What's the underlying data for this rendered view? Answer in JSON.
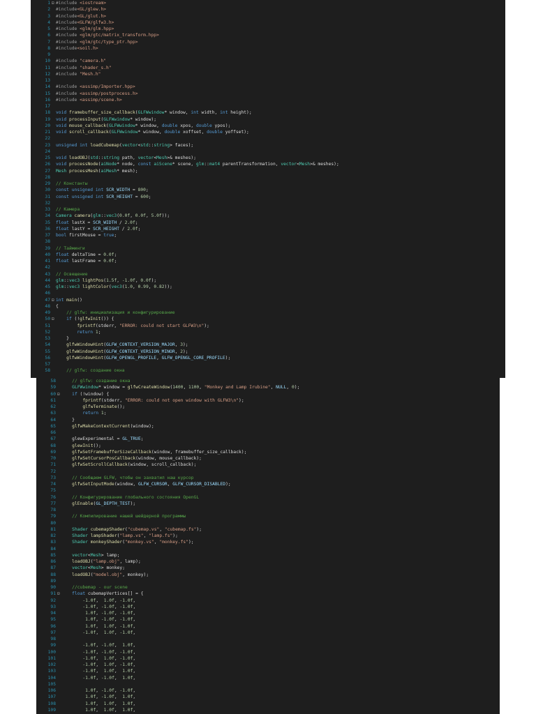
{
  "top_panel": {
    "lines": [
      {
        "n": "1",
        "t": "#include <iostream>"
      },
      {
        "n": "2",
        "t": "#include<GL/glew.h>"
      },
      {
        "n": "3",
        "t": "#include<GL/glut.h>"
      },
      {
        "n": "4",
        "t": "#include<GLFW/glfw3.h>"
      },
      {
        "n": "5",
        "t": "#include <glm/glm.hpp>"
      },
      {
        "n": "6",
        "t": "#include <glm/gtc/matrix_transform.hpp>"
      },
      {
        "n": "7",
        "t": "#include <glm/gtc/type_ptr.hpp>"
      },
      {
        "n": "8",
        "t": "#include<soil.h>"
      },
      {
        "n": "9",
        "t": ""
      },
      {
        "n": "10",
        "t": "#include \"camera.h\""
      },
      {
        "n": "11",
        "t": "#include \"shader_s.h\""
      },
      {
        "n": "12",
        "t": "#include \"Mesh.h\""
      },
      {
        "n": "13",
        "t": ""
      },
      {
        "n": "14",
        "t": "#include <assimp/Importer.hpp>"
      },
      {
        "n": "15",
        "t": "#include <assimp/postprocess.h>"
      },
      {
        "n": "16",
        "t": "#include <assimp/scene.h>"
      },
      {
        "n": "17",
        "t": ""
      },
      {
        "n": "18",
        "t": "void framebuffer_size_callback(GLFWwindow* window, int width, int height);"
      },
      {
        "n": "19",
        "t": "void processInput(GLFWwindow* window);"
      },
      {
        "n": "20",
        "t": "void mouse_callback(GLFWwindow* window, double xpos, double ypos);"
      },
      {
        "n": "21",
        "t": "void scroll_callback(GLFWwindow* window, double xoffset, double yoffset);"
      },
      {
        "n": "22",
        "t": ""
      },
      {
        "n": "23",
        "t": "unsigned int loadCubemap(vector<std::string> faces);"
      },
      {
        "n": "24",
        "t": ""
      },
      {
        "n": "25",
        "t": "void loadOBJ(std::string path, vector<Mesh>& meshes);"
      },
      {
        "n": "26",
        "t": "void processNode(aiNode* node, const aiScene* scene, glm::mat4 parentTransformation, vector<Mesh>& meshes);"
      },
      {
        "n": "27",
        "t": "Mesh processMesh(aiMesh* mesh);"
      },
      {
        "n": "28",
        "t": ""
      },
      {
        "n": "29",
        "t": "// Константы"
      },
      {
        "n": "30",
        "t": "const unsigned int SCR_WIDTH = 800;"
      },
      {
        "n": "31",
        "t": "const unsigned int SCR_HEIGHT = 600;"
      },
      {
        "n": "32",
        "t": ""
      },
      {
        "n": "33",
        "t": "// Камера"
      },
      {
        "n": "34",
        "t": "Camera camera(glm::vec3(0.0f, 0.0f, 5.0f));"
      },
      {
        "n": "35",
        "t": "float lastX = SCR_WIDTH / 2.0f;"
      },
      {
        "n": "36",
        "t": "float lastY = SCR_HEIGHT / 2.0f;"
      },
      {
        "n": "37",
        "t": "bool firstMouse = true;"
      },
      {
        "n": "38",
        "t": ""
      },
      {
        "n": "39",
        "t": "// Тайминги"
      },
      {
        "n": "40",
        "t": "float deltaTime = 0.0f;"
      },
      {
        "n": "41",
        "t": "float lastFrame = 0.0f;"
      },
      {
        "n": "42",
        "t": ""
      },
      {
        "n": "43",
        "t": "// Освещение"
      },
      {
        "n": "44",
        "t": "glm::vec3 lightPos(1.5f, -1.0f, 0.0f);"
      },
      {
        "n": "45",
        "t": "glm::vec3 lightColor(vec3(1.0, 0.99, 0.82));"
      },
      {
        "n": "46",
        "t": ""
      },
      {
        "n": "47",
        "t": "int main()"
      },
      {
        "n": "48",
        "t": "{"
      },
      {
        "n": "49",
        "t": "    // glfw: инициализация и конфигурирование"
      },
      {
        "n": "50",
        "t": "    if (!glfwInit()) {"
      },
      {
        "n": "51",
        "t": "        fprintf(stderr, \"ERROR: could not start GLFW3\\n\");"
      },
      {
        "n": "52",
        "t": "        return 1;"
      },
      {
        "n": "53",
        "t": "    }"
      },
      {
        "n": "54",
        "t": "    glfwWindowHint(GLFW_CONTEXT_VERSION_MAJOR, 3);"
      },
      {
        "n": "55",
        "t": "    glfwWindowHint(GLFW_CONTEXT_VERSION_MINOR, 2);"
      },
      {
        "n": "56",
        "t": "    glfwWindowHint(GLFW_OPENGL_PROFILE, GLFW_OPENGL_CORE_PROFILE);"
      },
      {
        "n": "57",
        "t": ""
      },
      {
        "n": "58",
        "t": "    // glfw: создание окна"
      }
    ]
  },
  "bottom_panel": {
    "lines": [
      {
        "n": "58",
        "t": "    // glfw: создание окна"
      },
      {
        "n": "59",
        "t": "    GLFWwindow* window = glfwCreateWindow(1400, 1100, \"Monkey and Lamp Irubine\", NULL, 0);"
      },
      {
        "n": "60",
        "t": "    if (!window) {"
      },
      {
        "n": "61",
        "t": "        fprintf(stderr, \"ERROR: could not open window with GLFW3\\n\");"
      },
      {
        "n": "62",
        "t": "        glfwTerminate();"
      },
      {
        "n": "63",
        "t": "        return 1;"
      },
      {
        "n": "64",
        "t": "    }"
      },
      {
        "n": "65",
        "t": "    glfwMakeContextCurrent(window);"
      },
      {
        "n": "66",
        "t": ""
      },
      {
        "n": "67",
        "t": "    glewExperimental = GL_TRUE;"
      },
      {
        "n": "68",
        "t": "    glewInit();"
      },
      {
        "n": "69",
        "t": "    glfwSetFramebufferSizeCallback(window, framebuffer_size_callback);"
      },
      {
        "n": "70",
        "t": "    glfwSetCursorPosCallback(window, mouse_callback);"
      },
      {
        "n": "71",
        "t": "    glfwSetScrollCallback(window, scroll_callback);"
      },
      {
        "n": "72",
        "t": ""
      },
      {
        "n": "73",
        "t": "    // Сообщаем GLFW, чтобы он захватил наш курсор"
      },
      {
        "n": "74",
        "t": "    glfwSetInputMode(window, GLFW_CURSOR, GLFW_CURSOR_DISABLED);"
      },
      {
        "n": "75",
        "t": ""
      },
      {
        "n": "76",
        "t": "    // Конфигурирование глобального состояния OpenGL"
      },
      {
        "n": "77",
        "t": "    glEnable(GL_DEPTH_TEST);"
      },
      {
        "n": "78",
        "t": ""
      },
      {
        "n": "79",
        "t": "    // Компилирование нашей шейдерной программы"
      },
      {
        "n": "80",
        "t": ""
      },
      {
        "n": "81",
        "t": "    Shader cubemapShader(\"cubemap.vs\", \"cubemap.fs\");"
      },
      {
        "n": "82",
        "t": "    Shader lampShader(\"lamp.vs\", \"lamp.fs\");"
      },
      {
        "n": "83",
        "t": "    Shader monkeyShader(\"monkey.vs\", \"monkey.fs\");"
      },
      {
        "n": "84",
        "t": ""
      },
      {
        "n": "85",
        "t": "    vector<Mesh> lamp;"
      },
      {
        "n": "86",
        "t": "    loadOBJ(\"lamp.obj\", lamp);"
      },
      {
        "n": "87",
        "t": "    vector<Mesh> monkey;"
      },
      {
        "n": "88",
        "t": "    loadOBJ(\"model.obj\", monkey);"
      },
      {
        "n": "89",
        "t": ""
      },
      {
        "n": "90",
        "t": "    //cubemap - our scene"
      },
      {
        "n": "91",
        "t": "    float cubemapVertices[] = {"
      },
      {
        "n": "92",
        "t": "        -1.0f,  1.0f, -1.0f,"
      },
      {
        "n": "93",
        "t": "        -1.0f, -1.0f, -1.0f,"
      },
      {
        "n": "94",
        "t": "         1.0f, -1.0f, -1.0f,"
      },
      {
        "n": "95",
        "t": "         1.0f, -1.0f, -1.0f,"
      },
      {
        "n": "96",
        "t": "         1.0f,  1.0f, -1.0f,"
      },
      {
        "n": "97",
        "t": "        -1.0f,  1.0f, -1.0f,"
      },
      {
        "n": "98",
        "t": ""
      },
      {
        "n": "99",
        "t": "        -1.0f, -1.0f,  1.0f,"
      },
      {
        "n": "100",
        "t": "        -1.0f, -1.0f, -1.0f,"
      },
      {
        "n": "101",
        "t": "        -1.0f,  1.0f, -1.0f,"
      },
      {
        "n": "102",
        "t": "        -1.0f,  1.0f, -1.0f,"
      },
      {
        "n": "103",
        "t": "        -1.0f,  1.0f,  1.0f,"
      },
      {
        "n": "104",
        "t": "        -1.0f, -1.0f,  1.0f,"
      },
      {
        "n": "105",
        "t": ""
      },
      {
        "n": "106",
        "t": "         1.0f, -1.0f, -1.0f,"
      },
      {
        "n": "107",
        "t": "         1.0f, -1.0f,  1.0f,"
      },
      {
        "n": "108",
        "t": "         1.0f,  1.0f,  1.0f,"
      },
      {
        "n": "109",
        "t": "         1.0f,  1.0f,  1.0f,"
      }
    ]
  }
}
